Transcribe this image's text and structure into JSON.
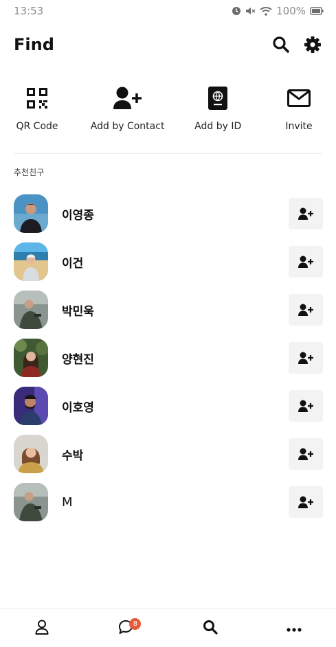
{
  "status_bar": {
    "time": "13:53",
    "battery": "100%"
  },
  "header": {
    "title": "Find"
  },
  "quick_actions": [
    {
      "label": "QR Code",
      "icon": "qr-code-icon"
    },
    {
      "label": "Add by Contact",
      "icon": "add-user-icon"
    },
    {
      "label": "Add by ID",
      "icon": "passport-icon"
    },
    {
      "label": "Invite",
      "icon": "envelope-icon"
    }
  ],
  "section_label": "추천친구",
  "friends": [
    {
      "name": "이영종"
    },
    {
      "name": "이건"
    },
    {
      "name": "박민욱"
    },
    {
      "name": "양현진"
    },
    {
      "name": "이호영"
    },
    {
      "name": "수박"
    },
    {
      "name": "M"
    }
  ],
  "bottom_nav": {
    "items": [
      "profile-icon",
      "chat-icon",
      "search-icon",
      "more-icon"
    ],
    "chat_badge": "8",
    "badge_color": "#e85a3a"
  }
}
